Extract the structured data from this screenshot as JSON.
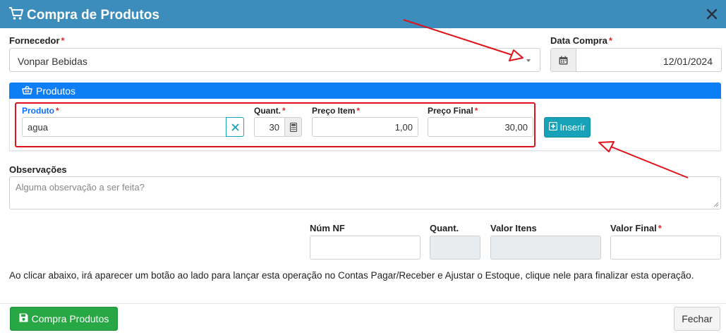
{
  "modal": {
    "title": "Compra de Produtos",
    "icons": {
      "title": "cart-icon",
      "close": "close-icon"
    }
  },
  "form": {
    "fornecedor": {
      "label": "Fornecedor",
      "required_mark": "*",
      "value": "Vonpar Bebidas"
    },
    "data_compra": {
      "label": "Data Compra",
      "required_mark": "*",
      "value": "12/01/2024"
    }
  },
  "produtos_panel": {
    "title": "Produtos",
    "produto": {
      "label": "Produto",
      "required_mark": "*",
      "value": "agua"
    },
    "quant": {
      "label": "Quant.",
      "required_mark": "*",
      "value": "30"
    },
    "preco_item": {
      "label": "Preço Item",
      "required_mark": "*",
      "value": "1,00"
    },
    "preco_final": {
      "label": "Preço Final",
      "required_mark": "*",
      "value": "30,00"
    },
    "insert_button": "Inserir"
  },
  "observacoes": {
    "label": "Observações",
    "placeholder": "Alguma observação a ser feita?"
  },
  "totals": {
    "num_nf": {
      "label": "Núm NF",
      "value": ""
    },
    "quant": {
      "label": "Quant.",
      "value": ""
    },
    "valor_itens": {
      "label": "Valor Itens",
      "value": ""
    },
    "valor_final": {
      "label": "Valor Final",
      "required_mark": "*",
      "value": ""
    }
  },
  "info_text": "Ao clicar abaixo, irá aparecer um botão ao lado para lançar esta operação no Contas Pagar/Receber e Ajustar o Estoque, clique nele para finalizar esta operação.",
  "footer": {
    "primary_button": "Compra Produtos",
    "close_button": "Fechar"
  },
  "colors": {
    "header": "#3c8dbc",
    "panel_header": "#0d7ef3",
    "required": "#dd2c2c",
    "highlight": "#e0121a",
    "info_button": "#17a2b8",
    "success_button": "#28a745"
  }
}
